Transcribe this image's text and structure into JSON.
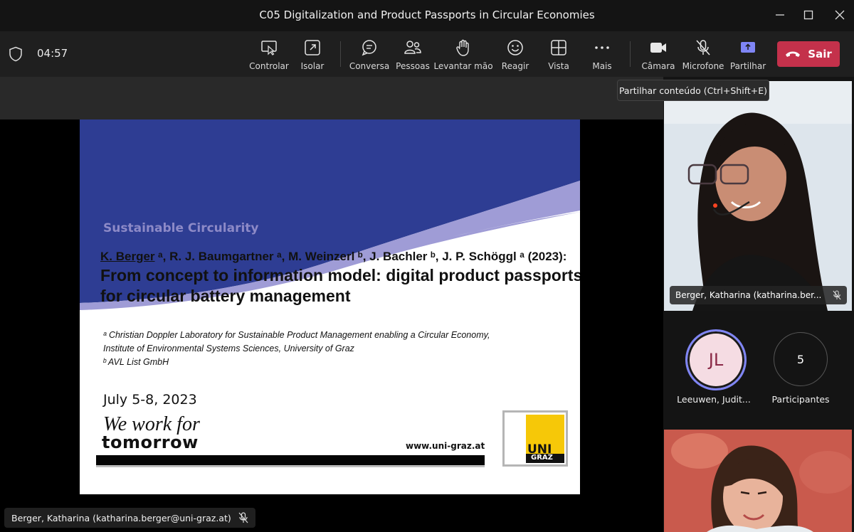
{
  "window": {
    "title": "C05 Digitalization and Product Passports in Circular Economies"
  },
  "toolbar": {
    "timer": "04:57",
    "items": [
      {
        "label": "Controlar",
        "icon": "screen-control-icon"
      },
      {
        "label": "Isolar",
        "icon": "pop-out-icon"
      },
      {
        "label": "Conversa",
        "icon": "chat-icon"
      },
      {
        "label": "Pessoas",
        "icon": "people-icon"
      },
      {
        "label": "Levantar mão",
        "icon": "raise-hand-icon"
      },
      {
        "label": "Reagir",
        "icon": "smiley-icon"
      },
      {
        "label": "Vista",
        "icon": "grid-view-icon"
      },
      {
        "label": "Mais",
        "icon": "more-icon"
      },
      {
        "label": "Câmara",
        "icon": "camera-icon"
      },
      {
        "label": "Microfone",
        "icon": "mic-muted-icon"
      },
      {
        "label": "Partilhar",
        "icon": "share-icon"
      }
    ],
    "leave_label": "Sair",
    "tooltip": "Partilhar conteúdo (Ctrl+Shift+E)"
  },
  "slide": {
    "kicker": "Sustainable Circularity",
    "authors_lead": "K. Berger",
    "authors_rest": " ᵃ, R. J. Baumgartner ᵃ, M. Weinzerl ᵇ, J. Bachler ᵇ, J. P. Schöggl ᵃ (2023):",
    "authors_sup_a": "ᵃ",
    "title_line1": "From concept to information model: digital product passports",
    "title_line2": "for circular battery management",
    "affil_line1": "ᵃ Christian Doppler Laboratory for Sustainable Product Management enabling a Circular Economy,",
    "affil_line2": "Institute of Environmental Systems Sciences, University of Graz",
    "affil_line3": "ᵇ AVL List GmbH",
    "date": "July 5-8, 2023",
    "motto_line1": "We work for",
    "motto_line2": "tomorrow",
    "url": "www.uni-graz.at",
    "logo_uni": "UNI",
    "logo_graz": "GRAZ",
    "colors": {
      "banner": "#2e3d93",
      "accent": "#8d8ac7"
    }
  },
  "presenter_label": "Berger, Katharina (katharina.berger@uni-graz.at)",
  "participants": {
    "video1_name": "Berger, Katharina (katharina.ber...",
    "tile1_initials": "JL",
    "tile1_name": "Leeuwen, Judit...",
    "tile2_count": "5",
    "tile2_label": "Participantes"
  }
}
